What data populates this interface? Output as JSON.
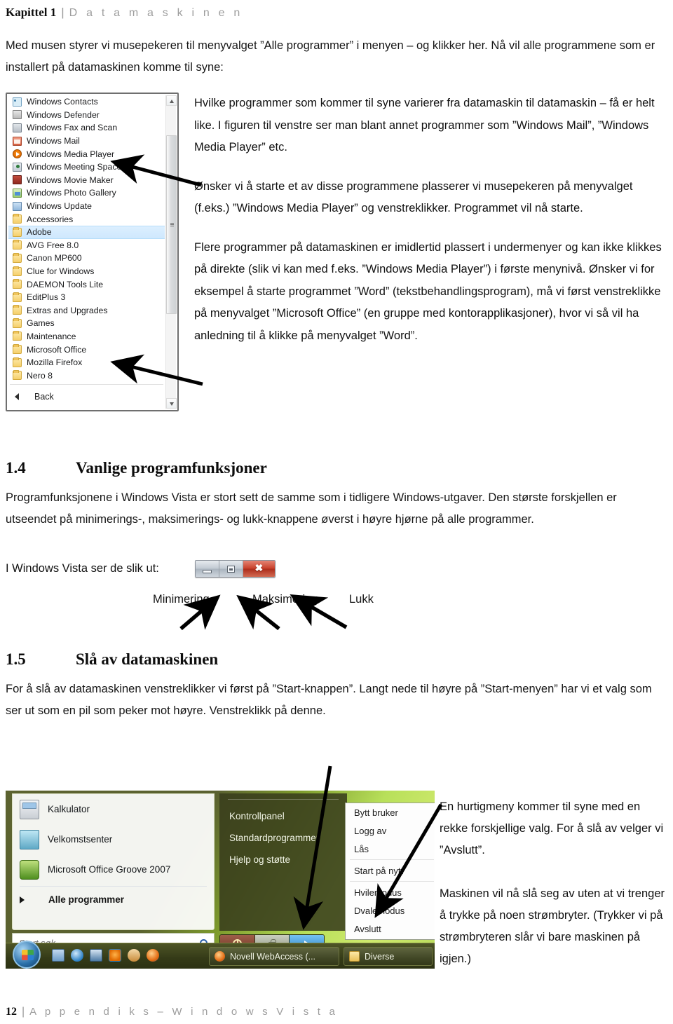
{
  "header": {
    "chapter": "Kapittel 1",
    "separator": "|",
    "title": "D a t a m a s k i n e n"
  },
  "intro": "Med musen styrer vi musepekeren til menyvalget ”Alle programmer” i menyen – og klikker her. Nå vil alle programmene som er installert på datamaskinen komme til syne:",
  "startmenu_top": {
    "items": [
      {
        "label": "Windows Contacts",
        "icon": "contacts-icon",
        "selected": false
      },
      {
        "label": "Windows Defender",
        "icon": "defender-icon",
        "selected": false
      },
      {
        "label": "Windows Fax and Scan",
        "icon": "fax-icon",
        "selected": false
      },
      {
        "label": "Windows Mail",
        "icon": "mail-icon",
        "selected": false
      },
      {
        "label": "Windows Media Player",
        "icon": "media-player-icon",
        "selected": false
      },
      {
        "label": "Windows Meeting Space",
        "icon": "meeting-space-icon",
        "selected": false
      },
      {
        "label": "Windows Movie Maker",
        "icon": "movie-maker-icon",
        "selected": false
      },
      {
        "label": "Windows Photo Gallery",
        "icon": "photo-gallery-icon",
        "selected": false
      },
      {
        "label": "Windows Update",
        "icon": "update-icon",
        "selected": false
      },
      {
        "label": "Accessories",
        "icon": "folder-icon",
        "selected": false
      },
      {
        "label": "Adobe",
        "icon": "folder-icon",
        "selected": true
      },
      {
        "label": "AVG Free 8.0",
        "icon": "folder-icon",
        "selected": false
      },
      {
        "label": "Canon MP600",
        "icon": "folder-icon",
        "selected": false
      },
      {
        "label": "Clue for Windows",
        "icon": "folder-icon",
        "selected": false
      },
      {
        "label": "DAEMON Tools Lite",
        "icon": "folder-icon",
        "selected": false
      },
      {
        "label": "EditPlus 3",
        "icon": "folder-icon",
        "selected": false
      },
      {
        "label": "Extras and Upgrades",
        "icon": "folder-icon",
        "selected": false
      },
      {
        "label": "Games",
        "icon": "folder-icon",
        "selected": false
      },
      {
        "label": "Maintenance",
        "icon": "folder-icon",
        "selected": false
      },
      {
        "label": "Microsoft Office",
        "icon": "folder-icon",
        "selected": false
      },
      {
        "label": "Mozilla Firefox",
        "icon": "folder-icon",
        "selected": false
      },
      {
        "label": "Nero 8",
        "icon": "folder-icon",
        "selected": false
      }
    ],
    "back_label": "Back"
  },
  "body": {
    "p1": "Hvilke programmer som kommer til syne varierer fra datamaskin til datamaskin – få er helt like. I figuren til venstre ser man blant annet programmer som ”Windows Mail”, ”Windows Media Player” etc.",
    "p2": "Ønsker vi å starte et av disse programmene plasserer vi musepekeren på menyvalget (f.eks.) ”Windows Media Player” og venstreklikker. Programmet vil nå starte.",
    "p3": "Flere programmer på datamaskinen er imidlertid plassert i undermenyer og kan ikke klikkes på direkte (slik vi kan med f.eks. ”Windows Media Player”) i første menynivå. Ønsker vi for eksempel å starte programmet ”Word” (tekstbehandlingsprogram), må vi først venstreklikke på menyvalget ”Microsoft Office” (en gruppe med kontorapplikasjoner), hvor vi så vil ha anledning til å klikke på menyvalget ”Word”."
  },
  "section14": {
    "number": "1.4",
    "title": "Vanlige programfunksjoner",
    "paragraph": "Programfunksjonene i Windows Vista er stort sett de samme som i tidligere Windows-utgaver. Den største forskjellen er utseendet på minimerings-, maksimerings- og lukk-knappene øverst i høyre hjørne på alle programmer.",
    "caption": "I Windows Vista ser de slik ut:",
    "buttons": [
      {
        "name": "minimize",
        "glyph": "minimize-icon",
        "label": "Minimering"
      },
      {
        "name": "maximize",
        "glyph": "maximize-icon",
        "label": "Maksimering"
      },
      {
        "name": "close",
        "glyph": "close-icon",
        "label": "Lukk"
      }
    ],
    "close_color": "#c8402b"
  },
  "section15": {
    "number": "1.5",
    "title": "Slå av datamaskinen",
    "paragraph": "For å slå av datamaskinen venstreklikker vi først på ”Start-knappen”. Langt nede til høyre på ”Start-menyen” har vi et valg som ser ut som en pil som peker mot høyre. Venstreklikk på denne."
  },
  "startmenu_bottom": {
    "left_items": [
      {
        "label": "Kalkulator",
        "icon": "calculator-icon"
      },
      {
        "label": "Velkomstsenter",
        "icon": "welcome-center-icon"
      },
      {
        "label": "Microsoft Office Groove 2007",
        "icon": "groove-icon"
      }
    ],
    "all_programs": "Alle programmer",
    "search_placeholder": "Start søk",
    "right_items": [
      "Kontrollpanel",
      "Standardprogrammer",
      "Hjelp og støtte"
    ],
    "power_buttons": [
      {
        "name": "shutdown-button",
        "icon": "power-icon"
      },
      {
        "name": "lock-button",
        "icon": "lock-icon"
      },
      {
        "name": "more-options-button",
        "icon": "arrow-right-icon"
      }
    ],
    "context_menu": [
      "Bytt bruker",
      "Logg av",
      "Lås",
      "Start på nytt",
      "Hvilemodus",
      "Dvalemodus",
      "Avslutt"
    ],
    "taskbar": {
      "start_orb": "windows-start-orb",
      "quick_icons": [
        "show-desktop-icon",
        "internet-explorer-icon",
        "monitor-icon",
        "media-player-icon",
        "paint-icon",
        "firefox-icon"
      ],
      "tasks": [
        {
          "label": "Novell WebAccess (...",
          "icon": "firefox-icon"
        },
        {
          "label": "Diverse",
          "icon": "folder-icon"
        }
      ]
    }
  },
  "bottom_text": {
    "p1": "En hurtigmeny kommer til syne med en rekke forskjellige valg. For å slå av velger vi ”Avslutt”.",
    "p2": "Maskinen vil nå slå seg av uten at vi trenger å trykke på noen strømbryter. (Trykker vi på strømbryteren slår vi bare maskinen på igjen.)"
  },
  "footer": {
    "page": "12",
    "separator": "|",
    "text": "A p p e n d i k s  –  W i n d o w s   V i s t a"
  }
}
